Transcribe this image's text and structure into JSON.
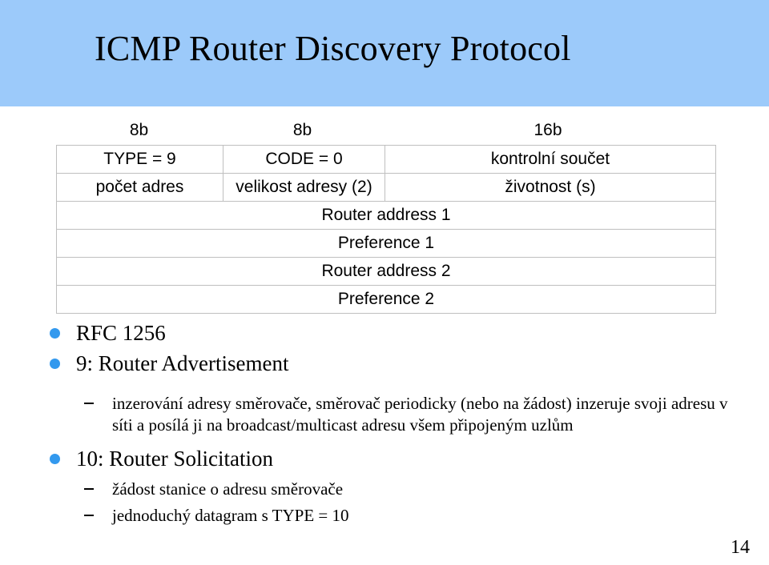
{
  "slide": {
    "title": "ICMP Router Discovery Protocol",
    "page_number": "14",
    "title_band_color": "#9CCAFA",
    "bullet_color": "#3399EE"
  },
  "packet": {
    "bit_widths": [
      "8b",
      "8b",
      "16b"
    ],
    "rows": [
      {
        "cells": [
          "TYPE = 9",
          "CODE = 0",
          "kontrolní součet"
        ]
      },
      {
        "cells": [
          "počet adres",
          "velikost adresy (2)",
          "životnost (s)"
        ]
      },
      {
        "cells": [
          "Router address 1"
        ]
      },
      {
        "cells": [
          "Preference 1"
        ]
      },
      {
        "cells": [
          "Router address 2"
        ]
      },
      {
        "cells": [
          "Preference 2"
        ]
      }
    ]
  },
  "bullets": {
    "rfc": "RFC 1256",
    "advertisement": "9: Router Advertisement",
    "advertisement_detail": "inzerování adresy směrovače, směrovač periodicky (nebo na žádost) inzeruje svoji adresu v síti a posílá ji na broadcast/multicast adresu všem připojeným uzlům",
    "solicitation": "10: Router Solicitation",
    "solicitation_detail_1": "žádost stanice o adresu směrovače",
    "solicitation_detail_2": "jednoduchý datagram s TYPE = 10"
  }
}
